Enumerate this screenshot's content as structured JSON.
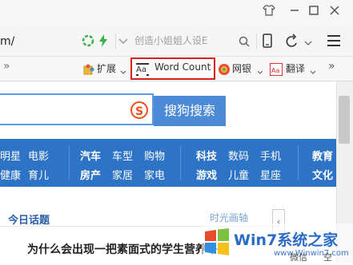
{
  "titlebar": {
    "window_buttons": [
      "shirt-icon",
      "minimize-icon",
      "maximize-icon",
      "close-icon"
    ]
  },
  "addressbar": {
    "url_visible": "m/",
    "search_placeholder": "创造小姐姐人设E"
  },
  "toolbar": {
    "left_chevron": "»",
    "extensions_label": "扩展",
    "word_count_label": "Word Count",
    "bank_label": "网银",
    "translate_label": "翻译",
    "more_label": "»",
    "highlight_color": "#d62020"
  },
  "page": {
    "search_button_label": "搜狗搜索",
    "nav_rows": [
      [
        "明星",
        "电影",
        "汽车",
        "车型",
        "购物",
        "科技",
        "数码",
        "手机",
        "教育"
      ],
      [
        "健康",
        "育儿",
        "房产",
        "家居",
        "家电",
        "游戏",
        "儿童",
        "星座",
        "文化"
      ]
    ],
    "topic_title": "今日话题",
    "watermark_text": "时光画轴",
    "prev_label": "‹",
    "headline": "为什么会出现一把素面式的学生营养午餐",
    "bottom_right_label": "微信",
    "bottom_right_label2": "空",
    "logo_text": "Win7系统之家",
    "logo_sub": "www.Winwin7.com",
    "nav_band_color": "#2e74c6",
    "accent_blue": "#4c8ad6"
  }
}
